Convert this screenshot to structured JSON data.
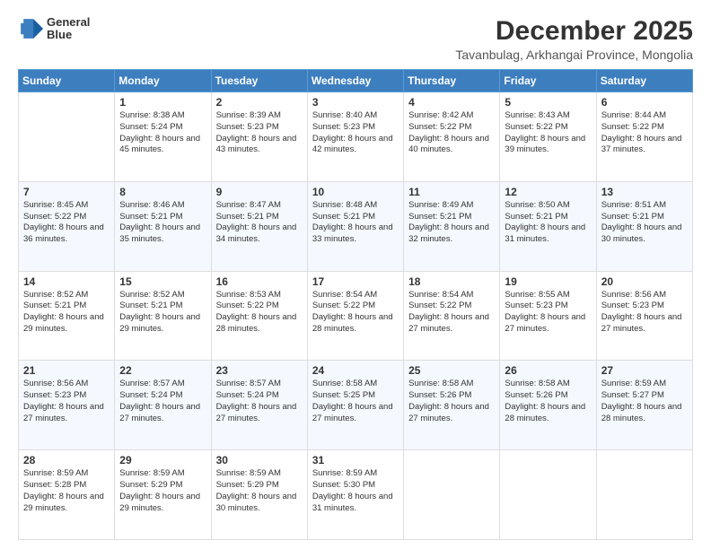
{
  "header": {
    "logo_line1": "General",
    "logo_line2": "Blue",
    "title": "December 2025",
    "subtitle": "Tavanbulag, Arkhangai Province, Mongolia"
  },
  "columns": [
    "Sunday",
    "Monday",
    "Tuesday",
    "Wednesday",
    "Thursday",
    "Friday",
    "Saturday"
  ],
  "weeks": [
    [
      {
        "day": "",
        "sunrise": "",
        "sunset": "",
        "daylight": ""
      },
      {
        "day": "1",
        "sunrise": "Sunrise: 8:38 AM",
        "sunset": "Sunset: 5:24 PM",
        "daylight": "Daylight: 8 hours and 45 minutes."
      },
      {
        "day": "2",
        "sunrise": "Sunrise: 8:39 AM",
        "sunset": "Sunset: 5:23 PM",
        "daylight": "Daylight: 8 hours and 43 minutes."
      },
      {
        "day": "3",
        "sunrise": "Sunrise: 8:40 AM",
        "sunset": "Sunset: 5:23 PM",
        "daylight": "Daylight: 8 hours and 42 minutes."
      },
      {
        "day": "4",
        "sunrise": "Sunrise: 8:42 AM",
        "sunset": "Sunset: 5:22 PM",
        "daylight": "Daylight: 8 hours and 40 minutes."
      },
      {
        "day": "5",
        "sunrise": "Sunrise: 8:43 AM",
        "sunset": "Sunset: 5:22 PM",
        "daylight": "Daylight: 8 hours and 39 minutes."
      },
      {
        "day": "6",
        "sunrise": "Sunrise: 8:44 AM",
        "sunset": "Sunset: 5:22 PM",
        "daylight": "Daylight: 8 hours and 37 minutes."
      }
    ],
    [
      {
        "day": "7",
        "sunrise": "Sunrise: 8:45 AM",
        "sunset": "Sunset: 5:22 PM",
        "daylight": "Daylight: 8 hours and 36 minutes."
      },
      {
        "day": "8",
        "sunrise": "Sunrise: 8:46 AM",
        "sunset": "Sunset: 5:21 PM",
        "daylight": "Daylight: 8 hours and 35 minutes."
      },
      {
        "day": "9",
        "sunrise": "Sunrise: 8:47 AM",
        "sunset": "Sunset: 5:21 PM",
        "daylight": "Daylight: 8 hours and 34 minutes."
      },
      {
        "day": "10",
        "sunrise": "Sunrise: 8:48 AM",
        "sunset": "Sunset: 5:21 PM",
        "daylight": "Daylight: 8 hours and 33 minutes."
      },
      {
        "day": "11",
        "sunrise": "Sunrise: 8:49 AM",
        "sunset": "Sunset: 5:21 PM",
        "daylight": "Daylight: 8 hours and 32 minutes."
      },
      {
        "day": "12",
        "sunrise": "Sunrise: 8:50 AM",
        "sunset": "Sunset: 5:21 PM",
        "daylight": "Daylight: 8 hours and 31 minutes."
      },
      {
        "day": "13",
        "sunrise": "Sunrise: 8:51 AM",
        "sunset": "Sunset: 5:21 PM",
        "daylight": "Daylight: 8 hours and 30 minutes."
      }
    ],
    [
      {
        "day": "14",
        "sunrise": "Sunrise: 8:52 AM",
        "sunset": "Sunset: 5:21 PM",
        "daylight": "Daylight: 8 hours and 29 minutes."
      },
      {
        "day": "15",
        "sunrise": "Sunrise: 8:52 AM",
        "sunset": "Sunset: 5:21 PM",
        "daylight": "Daylight: 8 hours and 29 minutes."
      },
      {
        "day": "16",
        "sunrise": "Sunrise: 8:53 AM",
        "sunset": "Sunset: 5:22 PM",
        "daylight": "Daylight: 8 hours and 28 minutes."
      },
      {
        "day": "17",
        "sunrise": "Sunrise: 8:54 AM",
        "sunset": "Sunset: 5:22 PM",
        "daylight": "Daylight: 8 hours and 28 minutes."
      },
      {
        "day": "18",
        "sunrise": "Sunrise: 8:54 AM",
        "sunset": "Sunset: 5:22 PM",
        "daylight": "Daylight: 8 hours and 27 minutes."
      },
      {
        "day": "19",
        "sunrise": "Sunrise: 8:55 AM",
        "sunset": "Sunset: 5:23 PM",
        "daylight": "Daylight: 8 hours and 27 minutes."
      },
      {
        "day": "20",
        "sunrise": "Sunrise: 8:56 AM",
        "sunset": "Sunset: 5:23 PM",
        "daylight": "Daylight: 8 hours and 27 minutes."
      }
    ],
    [
      {
        "day": "21",
        "sunrise": "Sunrise: 8:56 AM",
        "sunset": "Sunset: 5:23 PM",
        "daylight": "Daylight: 8 hours and 27 minutes."
      },
      {
        "day": "22",
        "sunrise": "Sunrise: 8:57 AM",
        "sunset": "Sunset: 5:24 PM",
        "daylight": "Daylight: 8 hours and 27 minutes."
      },
      {
        "day": "23",
        "sunrise": "Sunrise: 8:57 AM",
        "sunset": "Sunset: 5:24 PM",
        "daylight": "Daylight: 8 hours and 27 minutes."
      },
      {
        "day": "24",
        "sunrise": "Sunrise: 8:58 AM",
        "sunset": "Sunset: 5:25 PM",
        "daylight": "Daylight: 8 hours and 27 minutes."
      },
      {
        "day": "25",
        "sunrise": "Sunrise: 8:58 AM",
        "sunset": "Sunset: 5:26 PM",
        "daylight": "Daylight: 8 hours and 27 minutes."
      },
      {
        "day": "26",
        "sunrise": "Sunrise: 8:58 AM",
        "sunset": "Sunset: 5:26 PM",
        "daylight": "Daylight: 8 hours and 28 minutes."
      },
      {
        "day": "27",
        "sunrise": "Sunrise: 8:59 AM",
        "sunset": "Sunset: 5:27 PM",
        "daylight": "Daylight: 8 hours and 28 minutes."
      }
    ],
    [
      {
        "day": "28",
        "sunrise": "Sunrise: 8:59 AM",
        "sunset": "Sunset: 5:28 PM",
        "daylight": "Daylight: 8 hours and 29 minutes."
      },
      {
        "day": "29",
        "sunrise": "Sunrise: 8:59 AM",
        "sunset": "Sunset: 5:29 PM",
        "daylight": "Daylight: 8 hours and 29 minutes."
      },
      {
        "day": "30",
        "sunrise": "Sunrise: 8:59 AM",
        "sunset": "Sunset: 5:29 PM",
        "daylight": "Daylight: 8 hours and 30 minutes."
      },
      {
        "day": "31",
        "sunrise": "Sunrise: 8:59 AM",
        "sunset": "Sunset: 5:30 PM",
        "daylight": "Daylight: 8 hours and 31 minutes."
      },
      {
        "day": "",
        "sunrise": "",
        "sunset": "",
        "daylight": ""
      },
      {
        "day": "",
        "sunrise": "",
        "sunset": "",
        "daylight": ""
      },
      {
        "day": "",
        "sunrise": "",
        "sunset": "",
        "daylight": ""
      }
    ]
  ]
}
